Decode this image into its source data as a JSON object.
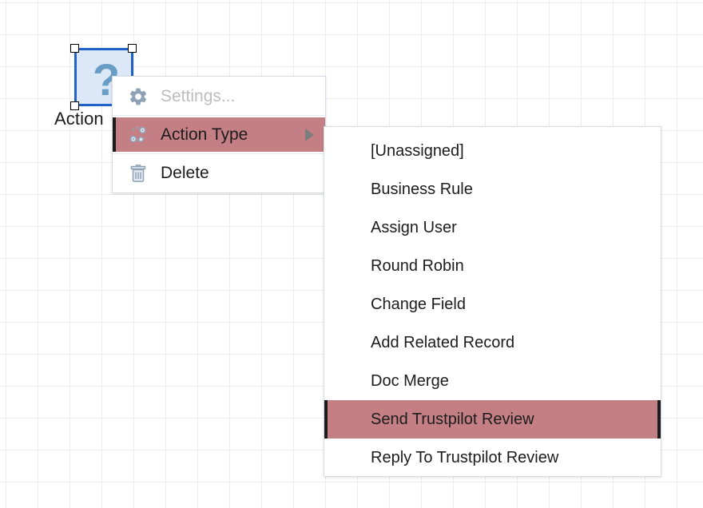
{
  "canvas": {
    "grid_color": "#ececec",
    "background": "#ffffff",
    "grid_size": 40
  },
  "node": {
    "label": "Action",
    "glyph": "?",
    "glyph_icon_name": "question-mark-icon",
    "fill": "#dce8f7",
    "border": "#1f62c8",
    "selected": true,
    "handles": [
      "top-left",
      "top-right",
      "bottom-left",
      "bottom-right"
    ]
  },
  "context_menu": {
    "items": [
      {
        "label": "Settings...",
        "icon": "gear-icon",
        "state": "disabled",
        "has_submenu": false
      },
      {
        "label": "Action Type",
        "icon": "action-type-icon",
        "state": "selected",
        "has_submenu": true
      },
      {
        "label": "Delete",
        "icon": "trash-icon",
        "state": "normal",
        "has_submenu": false
      }
    ],
    "highlight_color": "#c47f85"
  },
  "submenu": {
    "title": "Action Type",
    "items": [
      {
        "label": "[Unassigned]",
        "state": "normal"
      },
      {
        "label": "Business Rule",
        "state": "normal"
      },
      {
        "label": "Assign User",
        "state": "normal"
      },
      {
        "label": "Round Robin",
        "state": "normal"
      },
      {
        "label": "Change Field",
        "state": "normal"
      },
      {
        "label": "Add Related Record",
        "state": "normal"
      },
      {
        "label": "Doc Merge",
        "state": "normal"
      },
      {
        "label": "Send Trustpilot Review",
        "state": "selected"
      },
      {
        "label": "Reply To Trustpilot Review",
        "state": "normal"
      }
    ],
    "highlight_color": "#c47f85"
  }
}
